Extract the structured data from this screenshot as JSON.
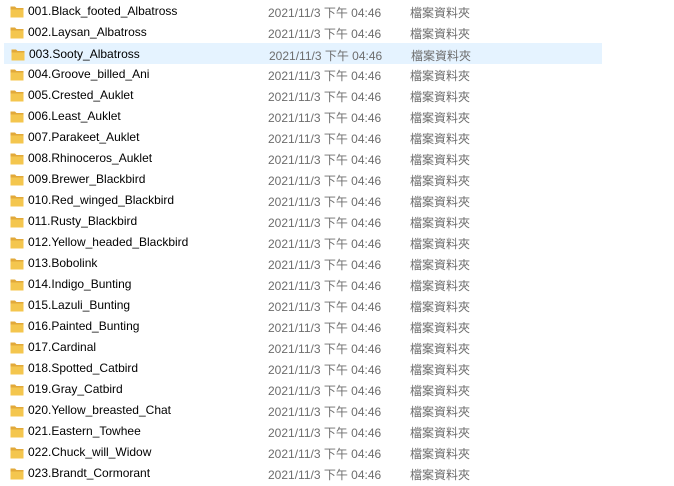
{
  "colors": {
    "folder": "#f4c64e",
    "folder_dark": "#e2a93a",
    "hover_bg": "#e5f3ff",
    "meta_text": "#6d6d6d"
  },
  "files": [
    {
      "name": "001.Black_footed_Albatross",
      "date": "2021/11/3 下午 04:46",
      "type": "檔案資料夾",
      "icon": "folder-icon"
    },
    {
      "name": "002.Laysan_Albatross",
      "date": "2021/11/3 下午 04:46",
      "type": "檔案資料夾",
      "icon": "folder-icon"
    },
    {
      "name": "003.Sooty_Albatross",
      "date": "2021/11/3 下午 04:46",
      "type": "檔案資料夾",
      "icon": "folder-icon",
      "hover": true
    },
    {
      "name": "004.Groove_billed_Ani",
      "date": "2021/11/3 下午 04:46",
      "type": "檔案資料夾",
      "icon": "folder-icon"
    },
    {
      "name": "005.Crested_Auklet",
      "date": "2021/11/3 下午 04:46",
      "type": "檔案資料夾",
      "icon": "folder-icon"
    },
    {
      "name": "006.Least_Auklet",
      "date": "2021/11/3 下午 04:46",
      "type": "檔案資料夾",
      "icon": "folder-icon"
    },
    {
      "name": "007.Parakeet_Auklet",
      "date": "2021/11/3 下午 04:46",
      "type": "檔案資料夾",
      "icon": "folder-icon"
    },
    {
      "name": "008.Rhinoceros_Auklet",
      "date": "2021/11/3 下午 04:46",
      "type": "檔案資料夾",
      "icon": "folder-icon"
    },
    {
      "name": "009.Brewer_Blackbird",
      "date": "2021/11/3 下午 04:46",
      "type": "檔案資料夾",
      "icon": "folder-icon"
    },
    {
      "name": "010.Red_winged_Blackbird",
      "date": "2021/11/3 下午 04:46",
      "type": "檔案資料夾",
      "icon": "folder-icon"
    },
    {
      "name": "011.Rusty_Blackbird",
      "date": "2021/11/3 下午 04:46",
      "type": "檔案資料夾",
      "icon": "folder-icon"
    },
    {
      "name": "012.Yellow_headed_Blackbird",
      "date": "2021/11/3 下午 04:46",
      "type": "檔案資料夾",
      "icon": "folder-icon"
    },
    {
      "name": "013.Bobolink",
      "date": "2021/11/3 下午 04:46",
      "type": "檔案資料夾",
      "icon": "folder-icon"
    },
    {
      "name": "014.Indigo_Bunting",
      "date": "2021/11/3 下午 04:46",
      "type": "檔案資料夾",
      "icon": "folder-icon"
    },
    {
      "name": "015.Lazuli_Bunting",
      "date": "2021/11/3 下午 04:46",
      "type": "檔案資料夾",
      "icon": "folder-icon"
    },
    {
      "name": "016.Painted_Bunting",
      "date": "2021/11/3 下午 04:46",
      "type": "檔案資料夾",
      "icon": "folder-icon"
    },
    {
      "name": "017.Cardinal",
      "date": "2021/11/3 下午 04:46",
      "type": "檔案資料夾",
      "icon": "folder-icon"
    },
    {
      "name": "018.Spotted_Catbird",
      "date": "2021/11/3 下午 04:46",
      "type": "檔案資料夾",
      "icon": "folder-icon"
    },
    {
      "name": "019.Gray_Catbird",
      "date": "2021/11/3 下午 04:46",
      "type": "檔案資料夾",
      "icon": "folder-icon"
    },
    {
      "name": "020.Yellow_breasted_Chat",
      "date": "2021/11/3 下午 04:46",
      "type": "檔案資料夾",
      "icon": "folder-icon"
    },
    {
      "name": "021.Eastern_Towhee",
      "date": "2021/11/3 下午 04:46",
      "type": "檔案資料夾",
      "icon": "folder-icon"
    },
    {
      "name": "022.Chuck_will_Widow",
      "date": "2021/11/3 下午 04:46",
      "type": "檔案資料夾",
      "icon": "folder-icon"
    },
    {
      "name": "023.Brandt_Cormorant",
      "date": "2021/11/3 下午 04:46",
      "type": "檔案資料夾",
      "icon": "folder-icon"
    }
  ]
}
